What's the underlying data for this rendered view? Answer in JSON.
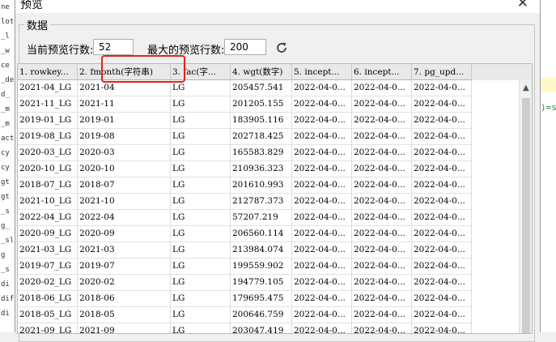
{
  "background": {
    "left_lines": [
      "ne",
      "lot",
      "_l",
      "_w",
      "ce",
      "_de",
      "d_",
      "_m",
      "_m",
      "act",
      "cy",
      "cy",
      "gt",
      "gt",
      "_s",
      "g_",
      "_sl",
      "g",
      "_s",
      "di",
      "dif",
      "di"
    ],
    "right_code": ")=s"
  },
  "dialog": {
    "title": "预览",
    "group_label": "数据",
    "current_rows_label": "当前预览行数:",
    "current_rows_value": "52",
    "max_rows_label": "最大的预览行数:",
    "max_rows_value": "200",
    "refresh_icon": "refresh-icon",
    "highlight_color": "#e5211d"
  },
  "table": {
    "columns": [
      "1. rowkey...",
      "2. fmonth(字符串)",
      "3. fac(字...",
      "4. wgt(数字)",
      "5. incept...",
      "6. incept...",
      "7. pg_upd..."
    ],
    "rows": [
      [
        "2021-04_LG",
        "2021-04",
        "LG",
        "205457.541",
        "2022-04-0...",
        "2022-04-0...",
        "2022-04-0..."
      ],
      [
        "2021-11_LG",
        "2021-11",
        "LG",
        "201205.155",
        "2022-04-0...",
        "2022-04-0...",
        "2022-04-0..."
      ],
      [
        "2019-01_LG",
        "2019-01",
        "LG",
        "183905.116",
        "2022-04-0...",
        "2022-04-0...",
        "2022-04-0..."
      ],
      [
        "2019-08_LG",
        "2019-08",
        "LG",
        "202718.425",
        "2022-04-0...",
        "2022-04-0...",
        "2022-04-0..."
      ],
      [
        "2020-03_LG",
        "2020-03",
        "LG",
        "165583.829",
        "2022-04-0...",
        "2022-04-0...",
        "2022-04-0..."
      ],
      [
        "2020-10_LG",
        "2020-10",
        "LG",
        "210936.323",
        "2022-04-0...",
        "2022-04-0...",
        "2022-04-0..."
      ],
      [
        "2018-07_LG",
        "2018-07",
        "LG",
        "201610.993",
        "2022-04-0...",
        "2022-04-0...",
        "2022-04-0..."
      ],
      [
        "2021-10_LG",
        "2021-10",
        "LG",
        "212787.373",
        "2022-04-0...",
        "2022-04-0...",
        "2022-04-0..."
      ],
      [
        "2022-04_LG",
        "2022-04",
        "LG",
        "57207.219",
        "2022-04-0...",
        "2022-04-0...",
        "2022-04-0..."
      ],
      [
        "2020-09_LG",
        "2020-09",
        "LG",
        "206560.114",
        "2022-04-0...",
        "2022-04-0...",
        "2022-04-0..."
      ],
      [
        "2021-03_LG",
        "2021-03",
        "LG",
        "213984.074",
        "2022-04-0...",
        "2022-04-0...",
        "2022-04-0..."
      ],
      [
        "2019-07_LG",
        "2019-07",
        "LG",
        "199559.902",
        "2022-04-0...",
        "2022-04-0...",
        "2022-04-0..."
      ],
      [
        "2020-02_LG",
        "2020-02",
        "LG",
        "194779.105",
        "2022-04-0...",
        "2022-04-0...",
        "2022-04-0..."
      ],
      [
        "2018-06_LG",
        "2018-06",
        "LG",
        "179695.475",
        "2022-04-0...",
        "2022-04-0...",
        "2022-04-0..."
      ],
      [
        "2018-05_LG",
        "2018-05",
        "LG",
        "200646.759",
        "2022-04-0...",
        "2022-04-0...",
        "2022-04-0..."
      ],
      [
        "2021-09_LG",
        "2021-09",
        "LG",
        "203047.419",
        "2022-04-0...",
        "2022-04-0...",
        "2022-04-0..."
      ]
    ]
  }
}
